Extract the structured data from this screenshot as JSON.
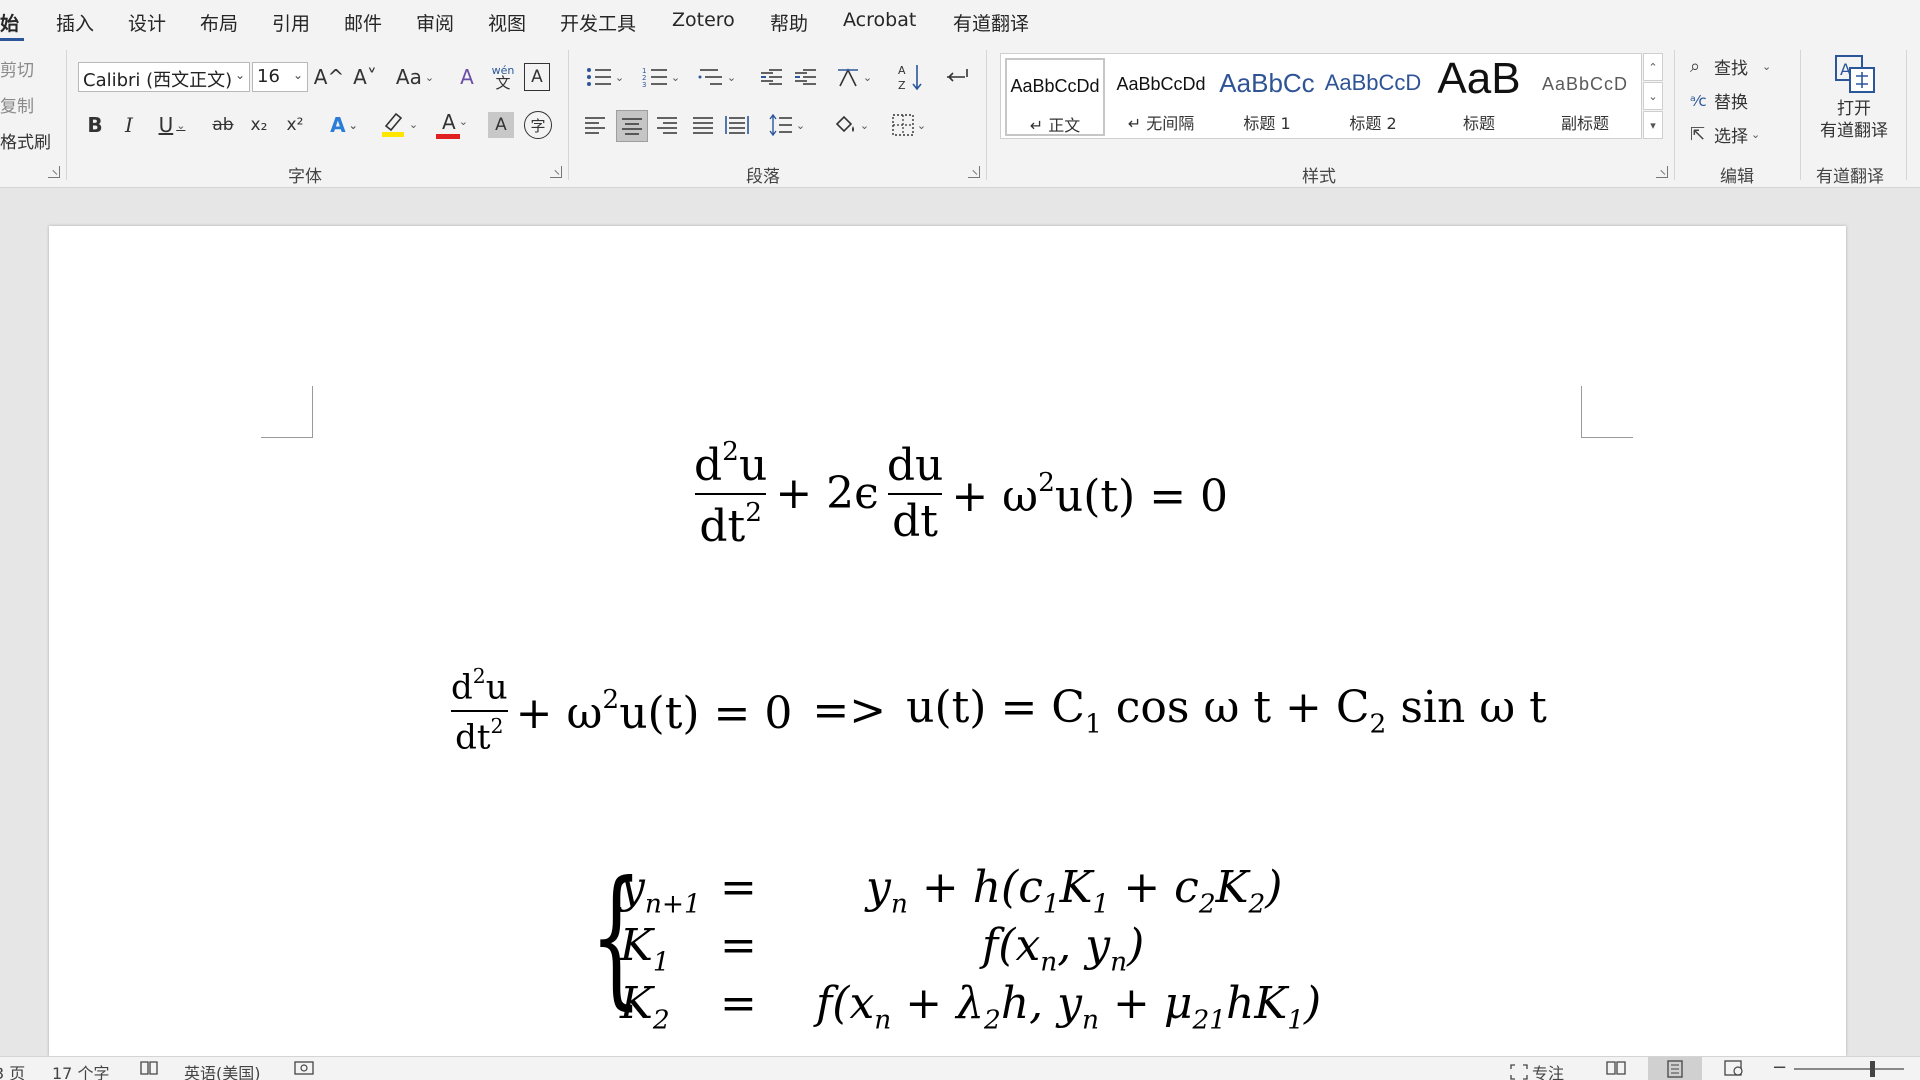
{
  "tabs": [
    "始",
    "插入",
    "设计",
    "布局",
    "引用",
    "邮件",
    "审阅",
    "视图",
    "开发工具",
    "Zotero",
    "帮助",
    "Acrobat",
    "有道翻译"
  ],
  "clipboard": {
    "cut": "剪切",
    "copy": "复制",
    "format_painter": "格式刷"
  },
  "font": {
    "name": "Calibri (西文正文)",
    "size": "16",
    "grow": "A^",
    "shrink": "A˅",
    "case": "Aa",
    "clear_format": "A",
    "phonetic_top": "wén",
    "phonetic_bottom": "文",
    "border_char": "A",
    "bold": "B",
    "italic": "I",
    "underline": "U",
    "strike": "ab",
    "subscript": "x₂",
    "superscript": "x²",
    "effects": "A",
    "font_color": "A",
    "shading_char": "A",
    "enclose": "字",
    "group_label": "字体"
  },
  "paragraph": {
    "group_label": "段落"
  },
  "styles": {
    "group_label": "样式",
    "items": [
      {
        "sample": "AaBbCcDd",
        "name": "↵ 正文"
      },
      {
        "sample": "AaBbCcDd",
        "name": "↵ 无间隔"
      },
      {
        "sample": "AaBbCc",
        "name": "标题 1"
      },
      {
        "sample": "AaBbCcD",
        "name": "标题 2"
      },
      {
        "sample": "AaB",
        "name": "标题"
      },
      {
        "sample": "AaBbCcD",
        "name": "副标题"
      }
    ]
  },
  "editing": {
    "find": "查找",
    "replace": "替换",
    "select": "选择",
    "group_label": "编辑"
  },
  "youdao": {
    "open_line1": "打开",
    "open_line2": "有道翻译",
    "group_label": "有道翻译"
  },
  "document": {
    "eq1": {
      "num1": "d",
      "sq": "2",
      "u": "u",
      "den1": "dt",
      "plus1": "+ 2ϵ",
      "num2": "du",
      "den2": "dt",
      "plus2": "+ ω",
      "tail": "u(t) = 0"
    },
    "eq2": {
      "left": "+ ω",
      "mid": "u(t) = 0",
      "arrow": "=>",
      "ut": "u(t) = C",
      "sub1": "1",
      "cos": "cos ω t + C",
      "sub2": "2",
      "sin": "sin ω t"
    },
    "system": {
      "rows": [
        {
          "lhs": "y",
          "lhs_sub": "n+1",
          "eq": "=",
          "rhs": "y",
          "rhs_rest": "+ h(c",
          "k1": "K",
          "k2": "+ c",
          "k3": "K",
          "close": ")"
        },
        {
          "lhs": "K",
          "lhs_sub": "1",
          "eq": "=",
          "rhs_text": "f(x",
          "rhs_mid": ", y",
          "rhs_close": ")"
        },
        {
          "lhs": "K",
          "lhs_sub": "2",
          "eq": "=",
          "rhs_text": "f(x",
          "rhs_a": "+ λ",
          "rhs_b": "h, y",
          "rhs_c": "+ μ",
          "rhs_d": "hK",
          "rhs_close": ")"
        }
      ]
    }
  },
  "status": {
    "page": "3 页",
    "words": "17 个字",
    "language": "英语(美国)",
    "focus": "专注"
  },
  "colors": {
    "accent": "#2b579a",
    "highlight": "#ffe600",
    "font_red": "#e02020"
  }
}
